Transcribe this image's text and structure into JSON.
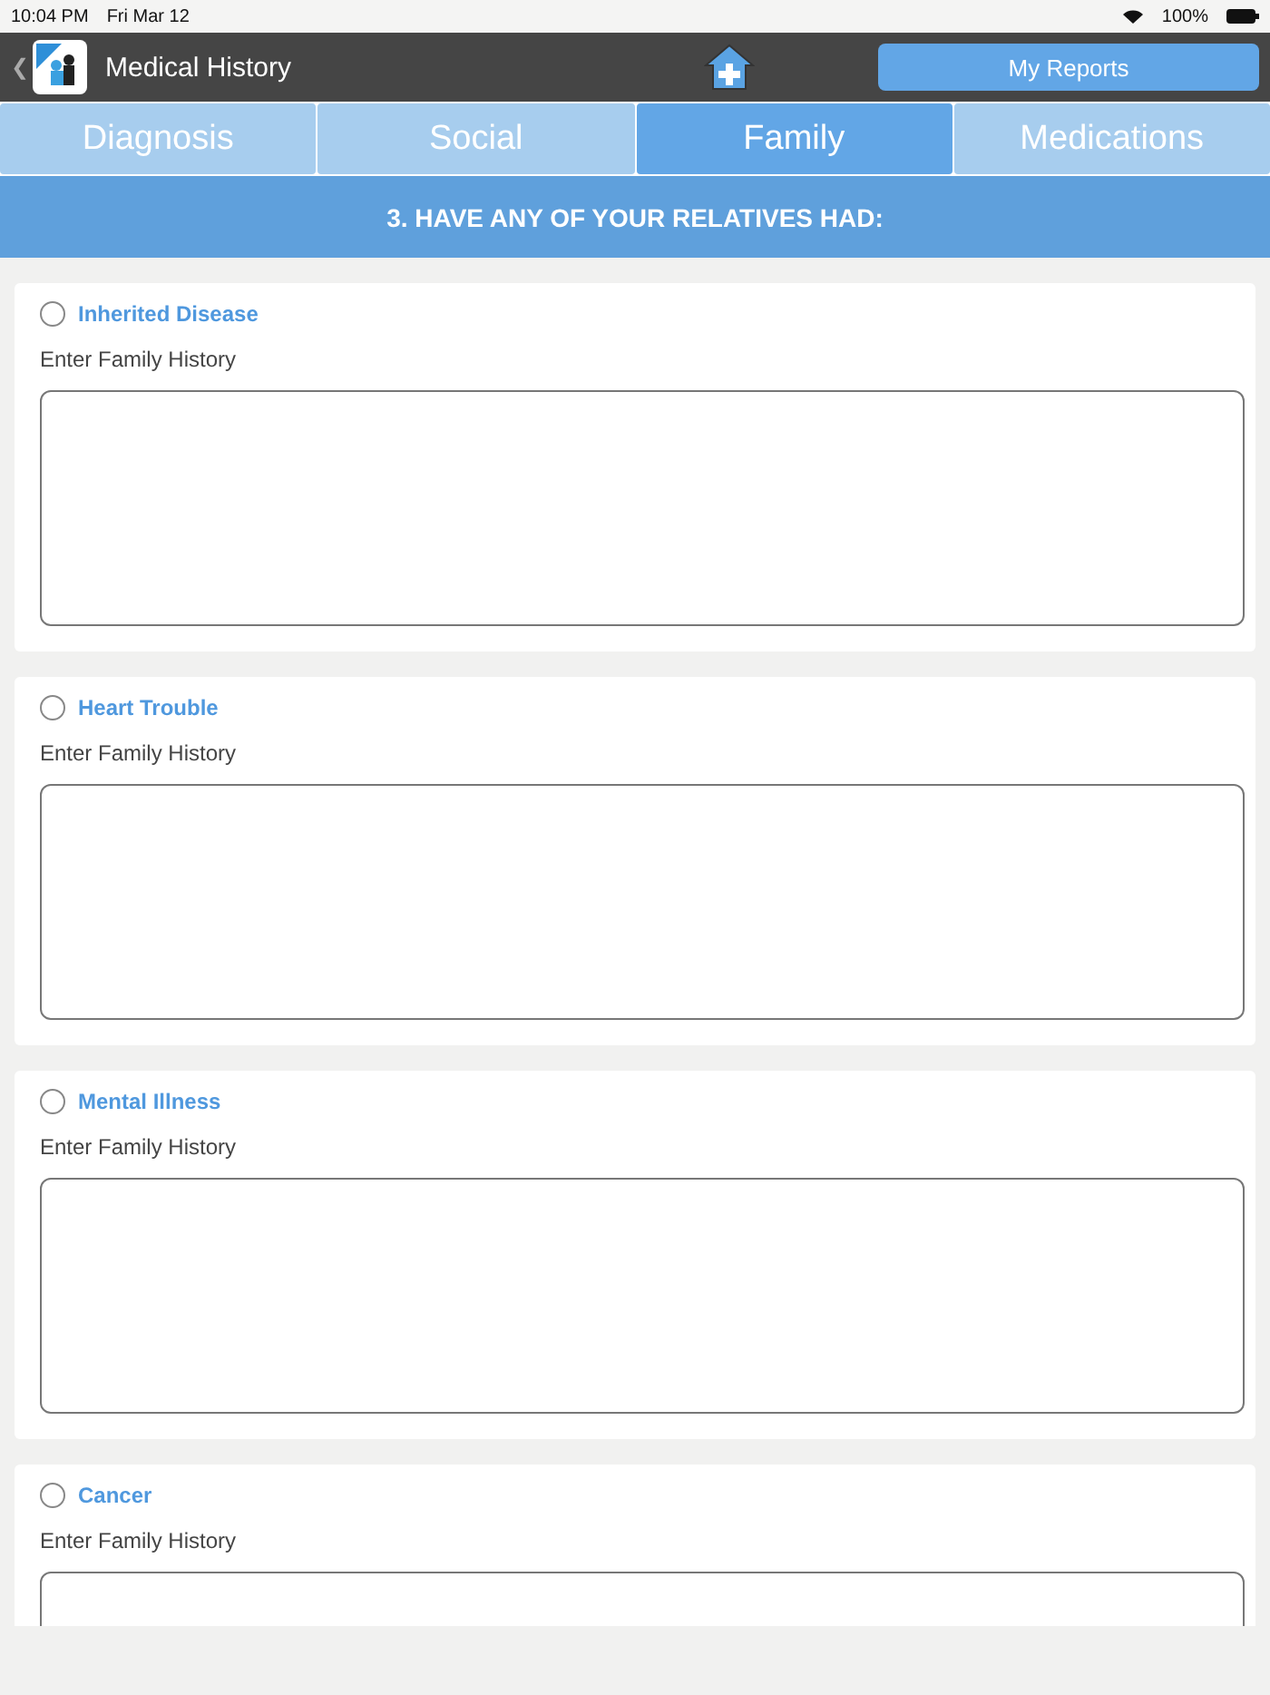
{
  "status_bar": {
    "time": "10:04 PM",
    "date": "Fri Mar 12",
    "battery": "100%"
  },
  "nav": {
    "back": "❮",
    "title": "Medical History",
    "reports_button": "My Reports"
  },
  "tabs": [
    {
      "label": "Diagnosis",
      "selected": false
    },
    {
      "label": "Social",
      "selected": false
    },
    {
      "label": "Family",
      "selected": true
    },
    {
      "label": "Medications",
      "selected": false
    }
  ],
  "section_title": "3. HAVE ANY OF YOUR RELATIVES HAD:",
  "conditions": [
    {
      "label": "Inherited Disease",
      "checked": false,
      "field_label": "Enter Family History"
    },
    {
      "label": "Heart Trouble",
      "checked": false,
      "field_label": "Enter Family History"
    },
    {
      "label": "Mental Illness",
      "checked": false,
      "field_label": "Enter Family History"
    },
    {
      "label": "Cancer",
      "checked": false,
      "field_label": "Enter Family History"
    }
  ]
}
